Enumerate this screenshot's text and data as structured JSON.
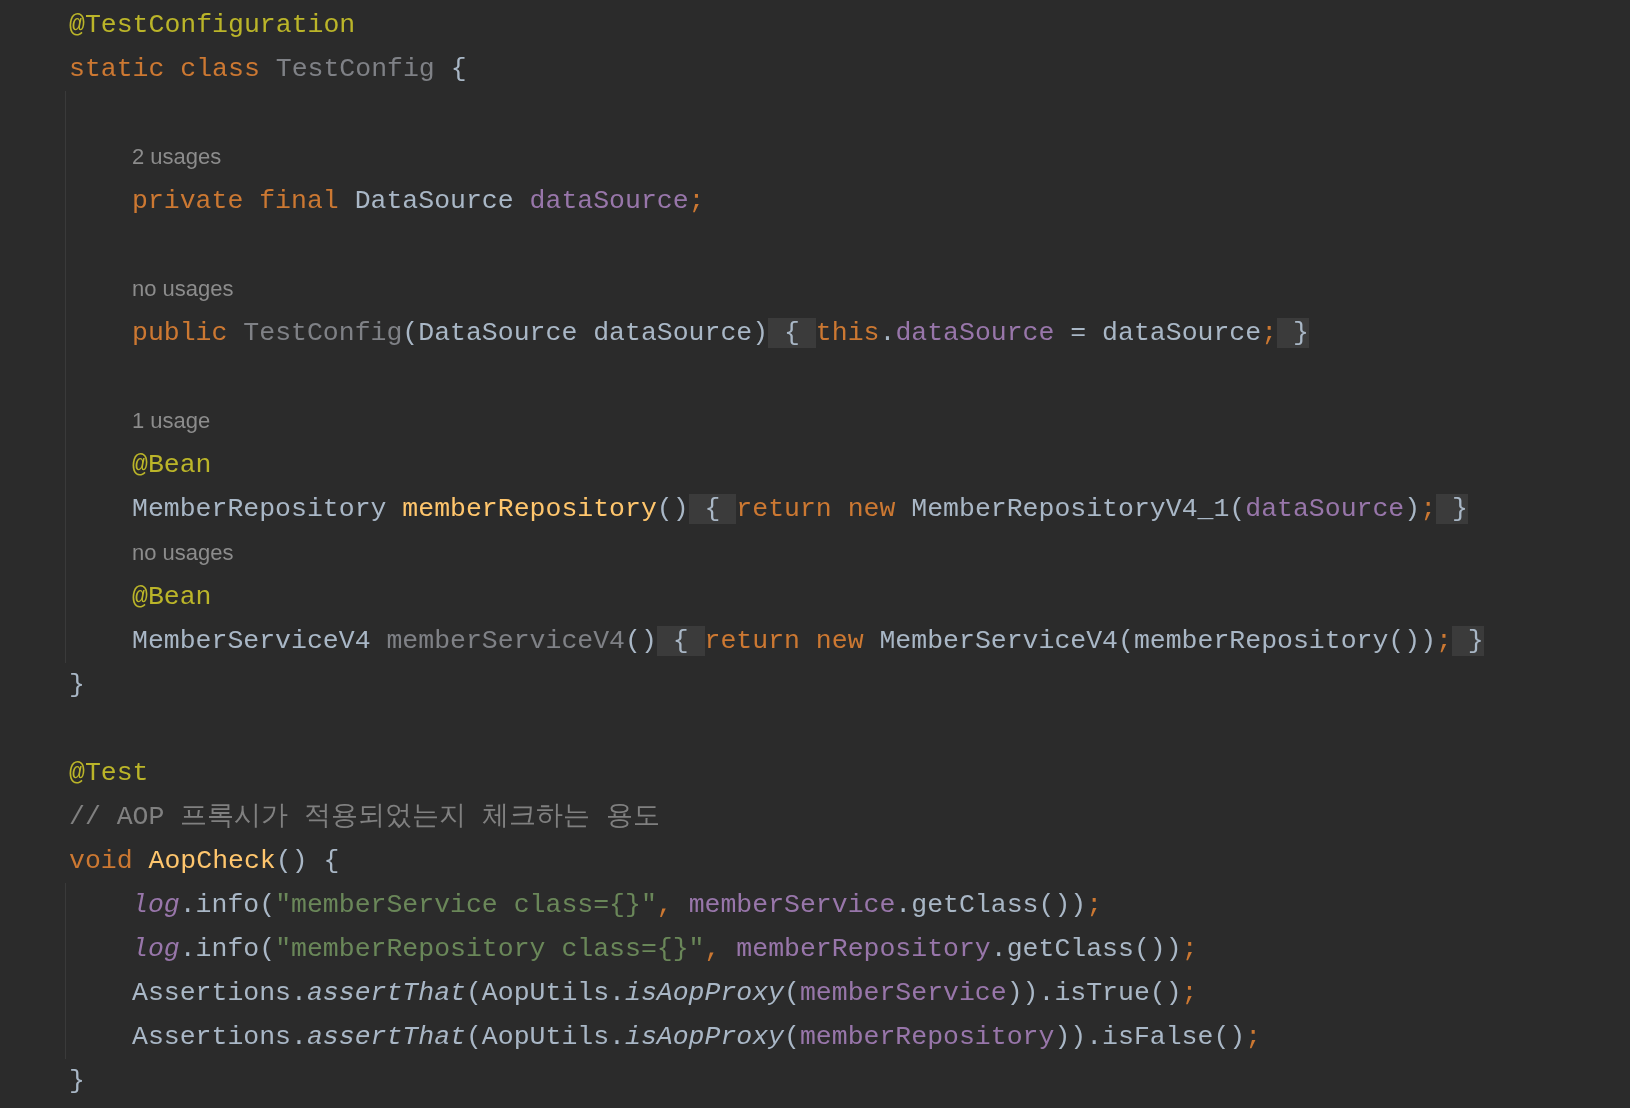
{
  "editor": {
    "lines": [
      {
        "kind": "code",
        "tokens": [
          {
            "kind": "ann",
            "text": "@TestConfiguration"
          }
        ]
      },
      {
        "kind": "code",
        "tokens": [
          {
            "kind": "kw",
            "text": "static class "
          },
          {
            "kind": "unused",
            "text": "TestConfig "
          },
          {
            "kind": "plain",
            "text": "{"
          }
        ],
        "children": [
          {
            "kind": "blank"
          },
          {
            "kind": "hint",
            "text": "2 usages"
          },
          {
            "kind": "code",
            "tokens": [
              {
                "kind": "kw",
                "text": "private final "
              },
              {
                "kind": "plain",
                "text": "DataSource "
              },
              {
                "kind": "field",
                "text": "dataSource"
              },
              {
                "kind": "kw",
                "text": ";"
              }
            ]
          },
          {
            "kind": "blank"
          },
          {
            "kind": "hint",
            "text": "no usages"
          },
          {
            "kind": "code",
            "tokens": [
              {
                "kind": "kw",
                "text": "public "
              },
              {
                "kind": "unused",
                "text": "TestConfig"
              },
              {
                "kind": "plain",
                "text": "(DataSource dataSource)"
              },
              {
                "kind": "fold",
                "text": " { "
              },
              {
                "kind": "kw",
                "text": "this"
              },
              {
                "kind": "plain",
                "text": "."
              },
              {
                "kind": "field",
                "text": "dataSource"
              },
              {
                "kind": "plain",
                "text": " = dataSource"
              },
              {
                "kind": "kw",
                "text": ";"
              },
              {
                "kind": "fold",
                "text": " }"
              }
            ]
          },
          {
            "kind": "blank"
          },
          {
            "kind": "hint",
            "text": "1 usage"
          },
          {
            "kind": "code",
            "tokens": [
              {
                "kind": "ann",
                "text": "@Bean"
              }
            ]
          },
          {
            "kind": "code",
            "tokens": [
              {
                "kind": "plain",
                "text": "MemberRepository "
              },
              {
                "kind": "decl",
                "text": "memberRepository"
              },
              {
                "kind": "plain",
                "text": "()"
              },
              {
                "kind": "fold",
                "text": " { "
              },
              {
                "kind": "kw",
                "text": "return new "
              },
              {
                "kind": "plain",
                "text": "MemberRepositoryV4_1("
              },
              {
                "kind": "field",
                "text": "dataSource"
              },
              {
                "kind": "plain",
                "text": ")"
              },
              {
                "kind": "kw",
                "text": ";"
              },
              {
                "kind": "fold",
                "text": " }"
              }
            ]
          },
          {
            "kind": "hint",
            "text": "no usages"
          },
          {
            "kind": "code",
            "tokens": [
              {
                "kind": "ann",
                "text": "@Bean"
              }
            ]
          },
          {
            "kind": "code",
            "tokens": [
              {
                "kind": "plain",
                "text": "MemberServiceV4 "
              },
              {
                "kind": "unused",
                "text": "memberServiceV4"
              },
              {
                "kind": "plain",
                "text": "()"
              },
              {
                "kind": "fold",
                "text": " { "
              },
              {
                "kind": "kw",
                "text": "return new "
              },
              {
                "kind": "plain",
                "text": "MemberServiceV4(memberRepository())"
              },
              {
                "kind": "kw",
                "text": ";"
              },
              {
                "kind": "fold",
                "text": " }"
              }
            ]
          }
        ]
      },
      {
        "kind": "code",
        "tokens": [
          {
            "kind": "plain",
            "text": "}"
          }
        ]
      },
      {
        "kind": "blank"
      },
      {
        "kind": "code",
        "tokens": [
          {
            "kind": "ann",
            "text": "@Test"
          }
        ]
      },
      {
        "kind": "code",
        "tokens": [
          {
            "kind": "comment",
            "text": "// AOP 프록시가 적용되었는지 체크하는 용도"
          }
        ]
      },
      {
        "kind": "code",
        "tokens": [
          {
            "kind": "kw",
            "text": "void "
          },
          {
            "kind": "decl",
            "text": "AopCheck"
          },
          {
            "kind": "plain",
            "text": "() {"
          }
        ],
        "children": [
          {
            "kind": "code",
            "tokens": [
              {
                "kind": "field-italic",
                "text": "log"
              },
              {
                "kind": "plain",
                "text": ".info("
              },
              {
                "kind": "str",
                "text": "\"memberService class={}\""
              },
              {
                "kind": "kw",
                "text": ", "
              },
              {
                "kind": "field",
                "text": "memberService"
              },
              {
                "kind": "plain",
                "text": ".getClass())"
              },
              {
                "kind": "kw",
                "text": ";"
              }
            ]
          },
          {
            "kind": "code",
            "tokens": [
              {
                "kind": "field-italic",
                "text": "log"
              },
              {
                "kind": "plain",
                "text": ".info("
              },
              {
                "kind": "str",
                "text": "\"memberRepository class={}\""
              },
              {
                "kind": "kw",
                "text": ", "
              },
              {
                "kind": "field",
                "text": "memberRepository"
              },
              {
                "kind": "plain",
                "text": ".getClass())"
              },
              {
                "kind": "kw",
                "text": ";"
              }
            ]
          },
          {
            "kind": "code",
            "tokens": [
              {
                "kind": "plain",
                "text": "Assertions."
              },
              {
                "kind": "italic",
                "text": "assertThat"
              },
              {
                "kind": "plain",
                "text": "(AopUtils."
              },
              {
                "kind": "italic",
                "text": "isAopProxy"
              },
              {
                "kind": "plain",
                "text": "("
              },
              {
                "kind": "field",
                "text": "memberService"
              },
              {
                "kind": "plain",
                "text": ")).isTrue()"
              },
              {
                "kind": "kw",
                "text": ";"
              }
            ]
          },
          {
            "kind": "code",
            "tokens": [
              {
                "kind": "plain",
                "text": "Assertions."
              },
              {
                "kind": "italic",
                "text": "assertThat"
              },
              {
                "kind": "plain",
                "text": "(AopUtils."
              },
              {
                "kind": "italic",
                "text": "isAopProxy"
              },
              {
                "kind": "plain",
                "text": "("
              },
              {
                "kind": "field",
                "text": "memberRepository"
              },
              {
                "kind": "plain",
                "text": ")).isFalse()"
              },
              {
                "kind": "kw",
                "text": ";"
              }
            ]
          }
        ]
      },
      {
        "kind": "code",
        "tokens": [
          {
            "kind": "plain",
            "text": "}"
          }
        ]
      }
    ]
  }
}
